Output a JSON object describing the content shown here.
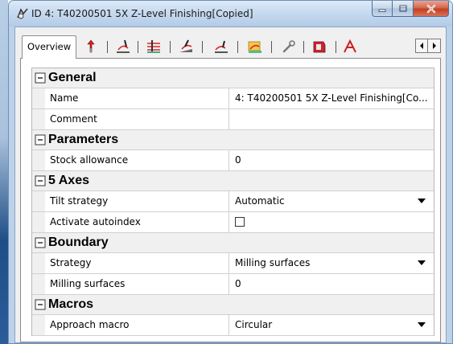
{
  "window": {
    "title": "ID 4: T40200501 5X Z-Level Finishing[Copied]",
    "icons": {
      "app": "toolpath-app-icon",
      "minimize": "minimize-icon",
      "maximize": "maximize-icon",
      "close": "close-icon"
    }
  },
  "tabs": {
    "active_label": "Overview",
    "icon_tabs": [
      "tool-icon",
      "z-level-strategy-icon",
      "parameters-icon",
      "5-axis-icon",
      "approach-icon",
      "macros-icon",
      "wrench-icon",
      "postprocessor-icon",
      "feature-icon"
    ],
    "scroll_icons": [
      "scroll-left-icon",
      "scroll-right-icon"
    ]
  },
  "grid": {
    "categories": [
      {
        "label": "General",
        "rows": [
          {
            "name": "Name",
            "value": "4: T40200501 5X Z-Level Finishing[Co...",
            "type": "text"
          },
          {
            "name": "Comment",
            "value": "",
            "type": "text"
          }
        ]
      },
      {
        "label": "Parameters",
        "rows": [
          {
            "name": "Stock allowance",
            "value": "0",
            "type": "text"
          }
        ]
      },
      {
        "label": "5 Axes",
        "rows": [
          {
            "name": "Tilt strategy",
            "value": "Automatic",
            "type": "dropdown"
          },
          {
            "name": "Activate autoindex",
            "value": "",
            "type": "checkbox",
            "checked": false
          }
        ]
      },
      {
        "label": "Boundary",
        "rows": [
          {
            "name": "Strategy",
            "value": "Milling surfaces",
            "type": "dropdown"
          },
          {
            "name": "Milling surfaces",
            "value": "0",
            "type": "text"
          }
        ]
      },
      {
        "label": "Macros",
        "rows": [
          {
            "name": "Approach macro",
            "value": "Circular",
            "type": "dropdown"
          }
        ]
      }
    ]
  },
  "colors": {
    "title_bar": "#c5d9ef",
    "close_button": "#c4401f",
    "category_bg": "#f0f0f0",
    "grid_line": "#d0d0d0"
  }
}
